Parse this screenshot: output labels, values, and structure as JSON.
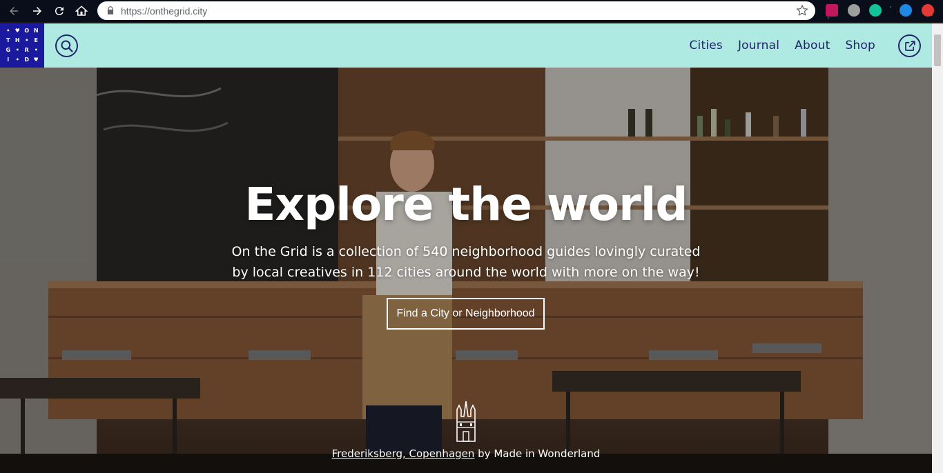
{
  "browser": {
    "url": "https://onthegrid.city"
  },
  "logo": {
    "cells": [
      "•",
      "♥",
      "O",
      "N",
      "T",
      "H",
      "•",
      "E",
      "G",
      "•",
      "R",
      "•",
      "I",
      "•",
      "D",
      "♥"
    ]
  },
  "nav": {
    "items": [
      {
        "label": "Cities"
      },
      {
        "label": "Journal"
      },
      {
        "label": "About"
      },
      {
        "label": "Shop"
      }
    ]
  },
  "hero": {
    "title": "Explore the world",
    "subtitle": "On the Grid is a collection of 540 neighborhood guides lovingly curated by local creatives in 112 cities around the world with more on the way!",
    "cta_label": "Find a City or Neighborhood",
    "credit_place": "Frederiksberg, Copenhagen",
    "credit_by": " by Made in Wonderland"
  },
  "colors": {
    "header_bg": "#aeeae2",
    "logo_bg": "#1b1a9e",
    "nav_text": "#23236a"
  }
}
